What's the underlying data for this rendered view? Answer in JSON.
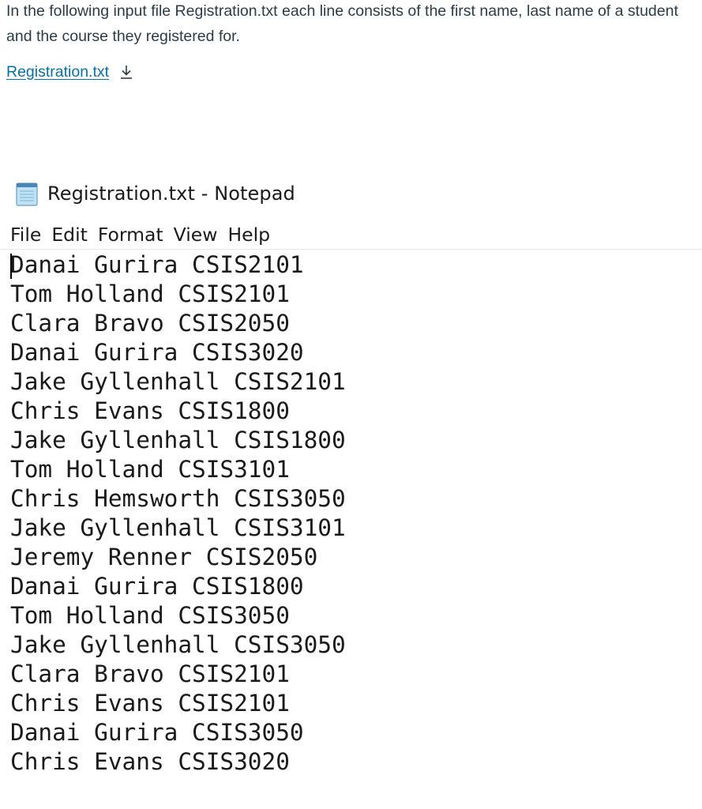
{
  "intro": {
    "text": "In the following input file Registration.txt each line consists of the first name, last name of a student and the course they registered for."
  },
  "file_link": {
    "label": "Registration.txt",
    "icon": "download-icon"
  },
  "notepad": {
    "title": "Registration.txt - Notepad",
    "app_icon": "notepad-icon",
    "menu": [
      "File",
      "Edit",
      "Format",
      "View",
      "Help"
    ],
    "lines": [
      "Danai Gurira CSIS2101",
      "Tom Holland CSIS2101",
      "Clara Bravo CSIS2050",
      "Danai Gurira CSIS3020",
      "Jake Gyllenhall CSIS2101",
      "Chris Evans CSIS1800",
      "Jake Gyllenhall CSIS1800",
      "Tom Holland CSIS3101",
      "Chris Hemsworth CSIS3050",
      "Jake Gyllenhall CSIS3101",
      "Jeremy Renner CSIS2050",
      "Danai Gurira CSIS1800",
      "Tom Holland CSIS3050",
      "Jake Gyllenhall CSIS3050",
      "Clara Bravo CSIS2101",
      "Chris Evans CSIS2101",
      "Danai Gurira CSIS3050",
      "Chris Evans CSIS3020"
    ]
  },
  "colors": {
    "link": "#0770a3",
    "text": "#2d3b45",
    "notepad_text": "#1a1a1a"
  }
}
